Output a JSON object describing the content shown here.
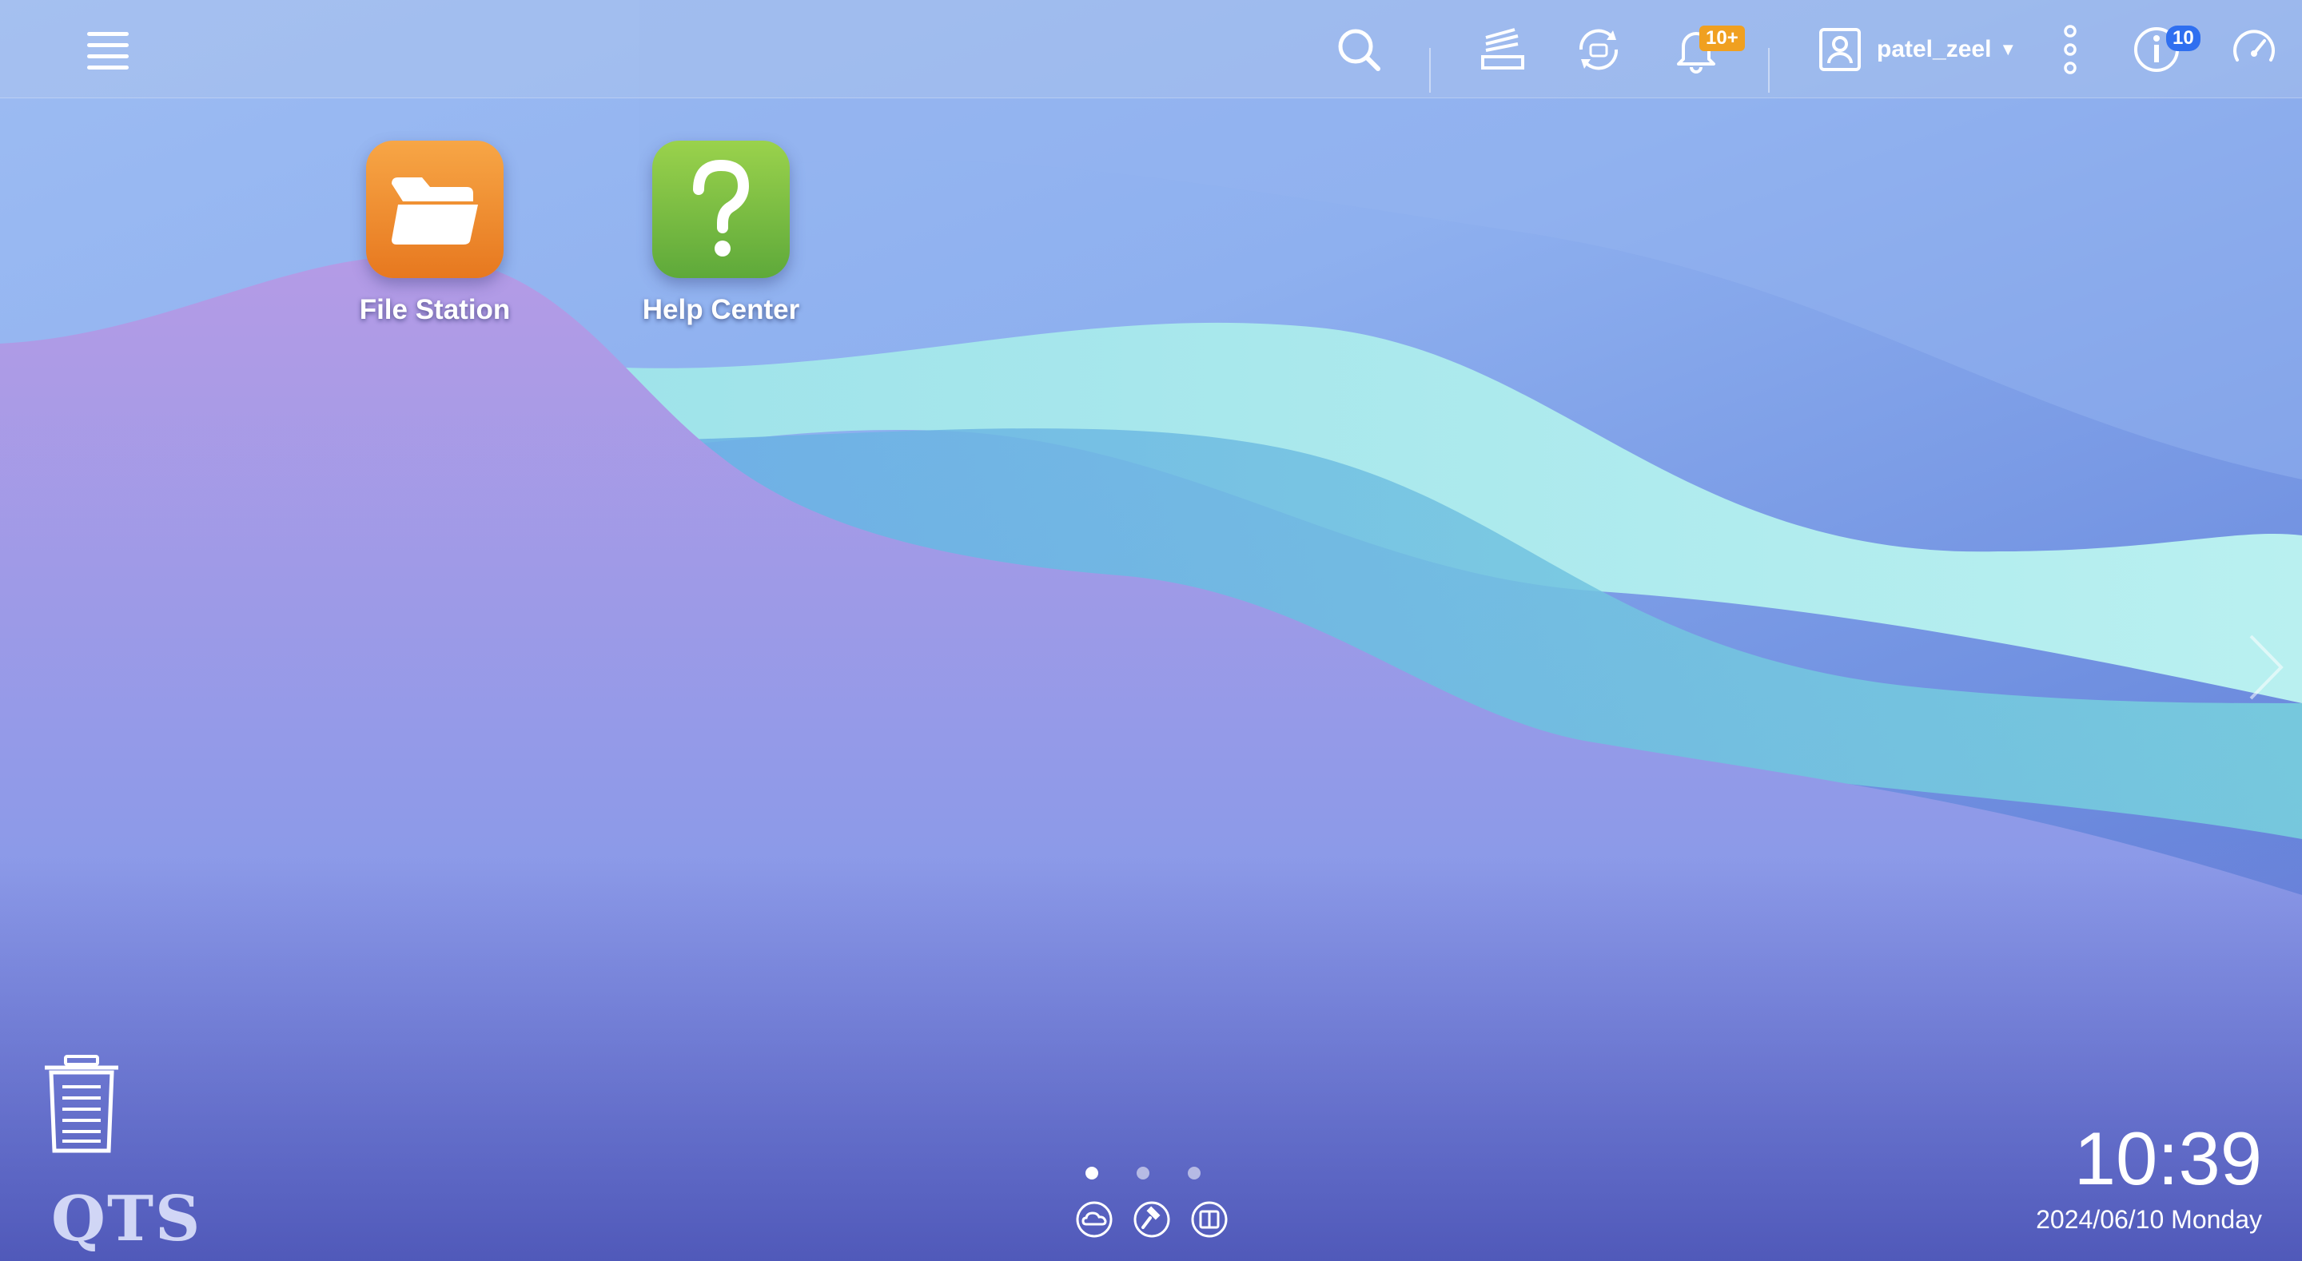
{
  "topbar": {
    "user_name": "patel_zeel",
    "notification_badge": "10+",
    "info_badge": "10"
  },
  "desktop": {
    "apps": [
      {
        "label": "File Station",
        "icon": "folder-icon",
        "color": "#ef8a2a"
      },
      {
        "label": "Help Center",
        "icon": "question-icon",
        "color": "#7bc142"
      }
    ]
  },
  "bottom": {
    "logo_text": "QTS",
    "pages": 3,
    "active_page": 1,
    "tools": [
      "cloud-icon",
      "hammer-icon",
      "book-icon"
    ]
  },
  "clock": {
    "time": "10:39",
    "date": "2024/06/10 Monday"
  },
  "colors": {
    "accent_badge": "#f0a020",
    "info_badge": "#2f6ff0"
  }
}
